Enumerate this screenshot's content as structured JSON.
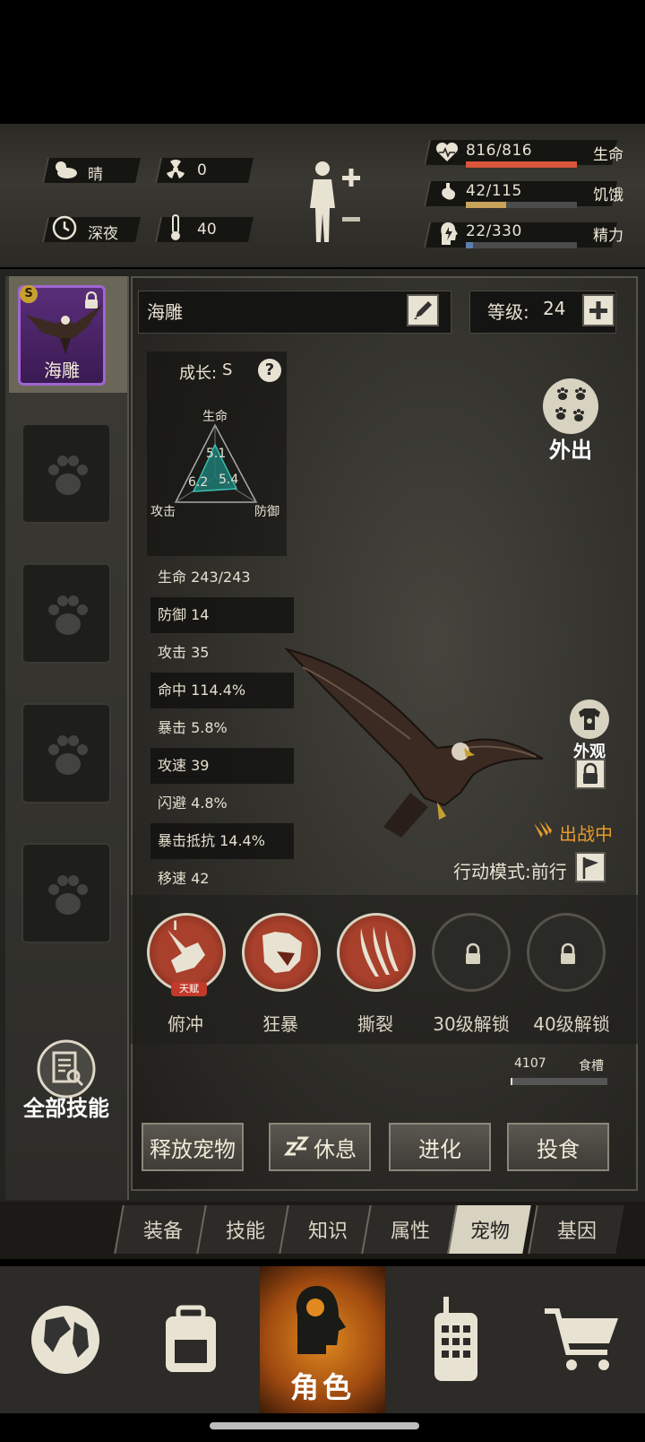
{
  "environment": {
    "weather": "晴",
    "radiation": "0",
    "time_of_day": "深夜",
    "temperature": "40"
  },
  "vitals": [
    {
      "label": "生命",
      "value": "816/816",
      "fraction": 1.0,
      "color": "#d9553c"
    },
    {
      "label": "饥饿",
      "value": "42/115",
      "fraction": 0.365,
      "color": "#c8a35a"
    },
    {
      "label": "精力",
      "value": "22/330",
      "fraction": 0.067,
      "color": "#5a7fae"
    }
  ],
  "pet": {
    "name": "海雕",
    "slot_name": "海雕",
    "rank_badge": "S",
    "level_label": "等级:",
    "level_value": "24",
    "growth_label": "成长:",
    "growth_value": "S",
    "radar": {
      "top_label": "生命",
      "left_label": "攻击",
      "right_label": "防御",
      "top_value": "5.1",
      "left_value": "6.2",
      "right_value": "5.4"
    },
    "stats": [
      {
        "label": "生命",
        "value": "243/243"
      },
      {
        "label": "防御",
        "value": "14"
      },
      {
        "label": "攻击",
        "value": "35"
      },
      {
        "label": "命中",
        "value": "114.4%"
      },
      {
        "label": "暴击",
        "value": "5.8%"
      },
      {
        "label": "攻速",
        "value": "39"
      },
      {
        "label": "闪避",
        "value": "4.8%"
      },
      {
        "label": "暴击抵抗",
        "value": "14.4%"
      },
      {
        "label": "移速",
        "value": "42"
      }
    ],
    "go_out_label": "外出",
    "appearance_label": "外观",
    "in_battle_label": "出战中",
    "action_mode_label": "行动模式:前行"
  },
  "skills": [
    {
      "label": "俯冲",
      "badge": "天赋",
      "tier": "I",
      "locked": false
    },
    {
      "label": "狂暴",
      "locked": false
    },
    {
      "label": "撕裂",
      "locked": false
    },
    {
      "label": "30级解锁",
      "locked": true
    },
    {
      "label": "40级解锁",
      "locked": true
    }
  ],
  "food": {
    "value": "4107",
    "label": "食槽",
    "fraction": 0.02
  },
  "all_skills_label": "全部技能",
  "actions": {
    "release": "释放宠物",
    "rest": "休息",
    "evolve": "进化",
    "feed": "投食"
  },
  "tabs": [
    "装备",
    "技能",
    "知识",
    "属性",
    "宠物",
    "基因"
  ],
  "active_tab": "宠物",
  "bottom_nav": {
    "active_label": "角色"
  },
  "colors": {
    "accent_orange": "#e89a2a",
    "active_nav": "#d87a1a"
  }
}
